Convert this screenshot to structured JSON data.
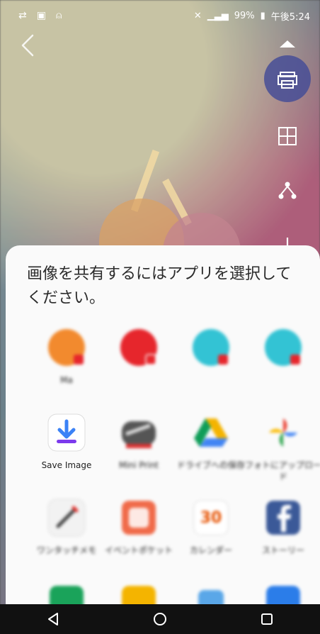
{
  "status_bar": {
    "battery": "99%",
    "time": "午後5:24"
  },
  "share_sheet": {
    "title": "画像を共有するにはアプリを選択してください。",
    "direct_share": [
      {
        "color": "#f28a2e",
        "label": "Ma"
      },
      {
        "color": "#e6262c",
        "label": ""
      },
      {
        "color": "#33c3d4",
        "label": ""
      },
      {
        "color": "#33c3d4",
        "label": ""
      }
    ],
    "apps_row_1": [
      {
        "label": "Save Image",
        "icon": "save-image-icon"
      },
      {
        "label": "Mini Print",
        "icon": "mini-print-icon"
      },
      {
        "label": "ドライブへの保存",
        "icon": "google-drive-icon"
      },
      {
        "label": "フォトにアップロード",
        "icon": "google-photos-icon"
      }
    ],
    "apps_row_2": [
      {
        "label": "ワンタッチメモ",
        "icon": "pencil-memo-icon"
      },
      {
        "label": "イベントポケット",
        "icon": "event-pocket-icon"
      },
      {
        "label": "カレンダー",
        "icon": "calendar-icon",
        "day": "30"
      },
      {
        "label": "ストーリー",
        "icon": "facebook-icon"
      }
    ]
  }
}
